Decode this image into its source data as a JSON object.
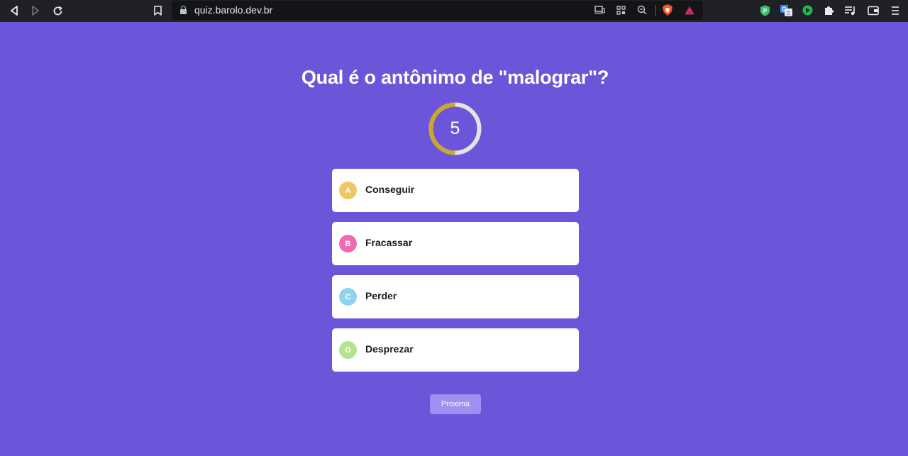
{
  "browser": {
    "url": "quiz.barolo.dev.br",
    "nav": {
      "back_icon": "back-arrow-icon",
      "forward_icon": "forward-arrow-icon",
      "reload_icon": "reload-icon",
      "bookmark_icon": "bookmark-icon"
    },
    "extensions": [
      "vpn-shield-icon",
      "translate-icon",
      "media-icon",
      "puzzle-icon",
      "playlist-icon",
      "wallet-icon",
      "menu-icon"
    ]
  },
  "quiz": {
    "question": "Qual é o antônimo de \"malograr\"?",
    "timer": {
      "value": "5",
      "progress_fraction": 0.5,
      "progress_color": "#c9a82b",
      "track_color": "#e3e3e3"
    },
    "options": [
      {
        "letter": "A",
        "text": "Conseguir",
        "color": "#eec763"
      },
      {
        "letter": "B",
        "text": "Fracassar",
        "color": "#ee6bb0"
      },
      {
        "letter": "C",
        "text": "Perder",
        "color": "#8fd4ee"
      },
      {
        "letter": "D",
        "text": "Desprezar",
        "color": "#b5e290"
      }
    ],
    "next_label": "Proxima"
  },
  "colors": {
    "background": "#6c55d9",
    "next_button": "#a08ef2"
  }
}
